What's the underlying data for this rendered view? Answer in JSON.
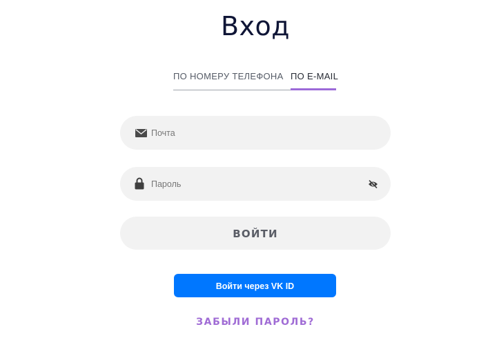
{
  "page": {
    "title": "Вход"
  },
  "tabs": [
    {
      "label": "ПО НОМЕРУ ТЕЛЕФОНА",
      "active": false
    },
    {
      "label": "ПО E-MAIL",
      "active": true
    }
  ],
  "form": {
    "email": {
      "placeholder": "Почта",
      "value": "",
      "icon": "envelope-icon"
    },
    "password": {
      "placeholder": "Пароль",
      "value": "",
      "icon": "lock-icon",
      "toggle_icon": "eye-slash-icon"
    },
    "submit_label": "ВОЙТИ",
    "vk_label": "Войти через VK ID",
    "forgot_label": "ЗАБЫЛИ ПАРОЛЬ?"
  },
  "colors": {
    "accent": "#a06cd5",
    "vk_blue": "#0077ff",
    "field_bg": "#f2f2f2",
    "title": "#0f1536"
  }
}
